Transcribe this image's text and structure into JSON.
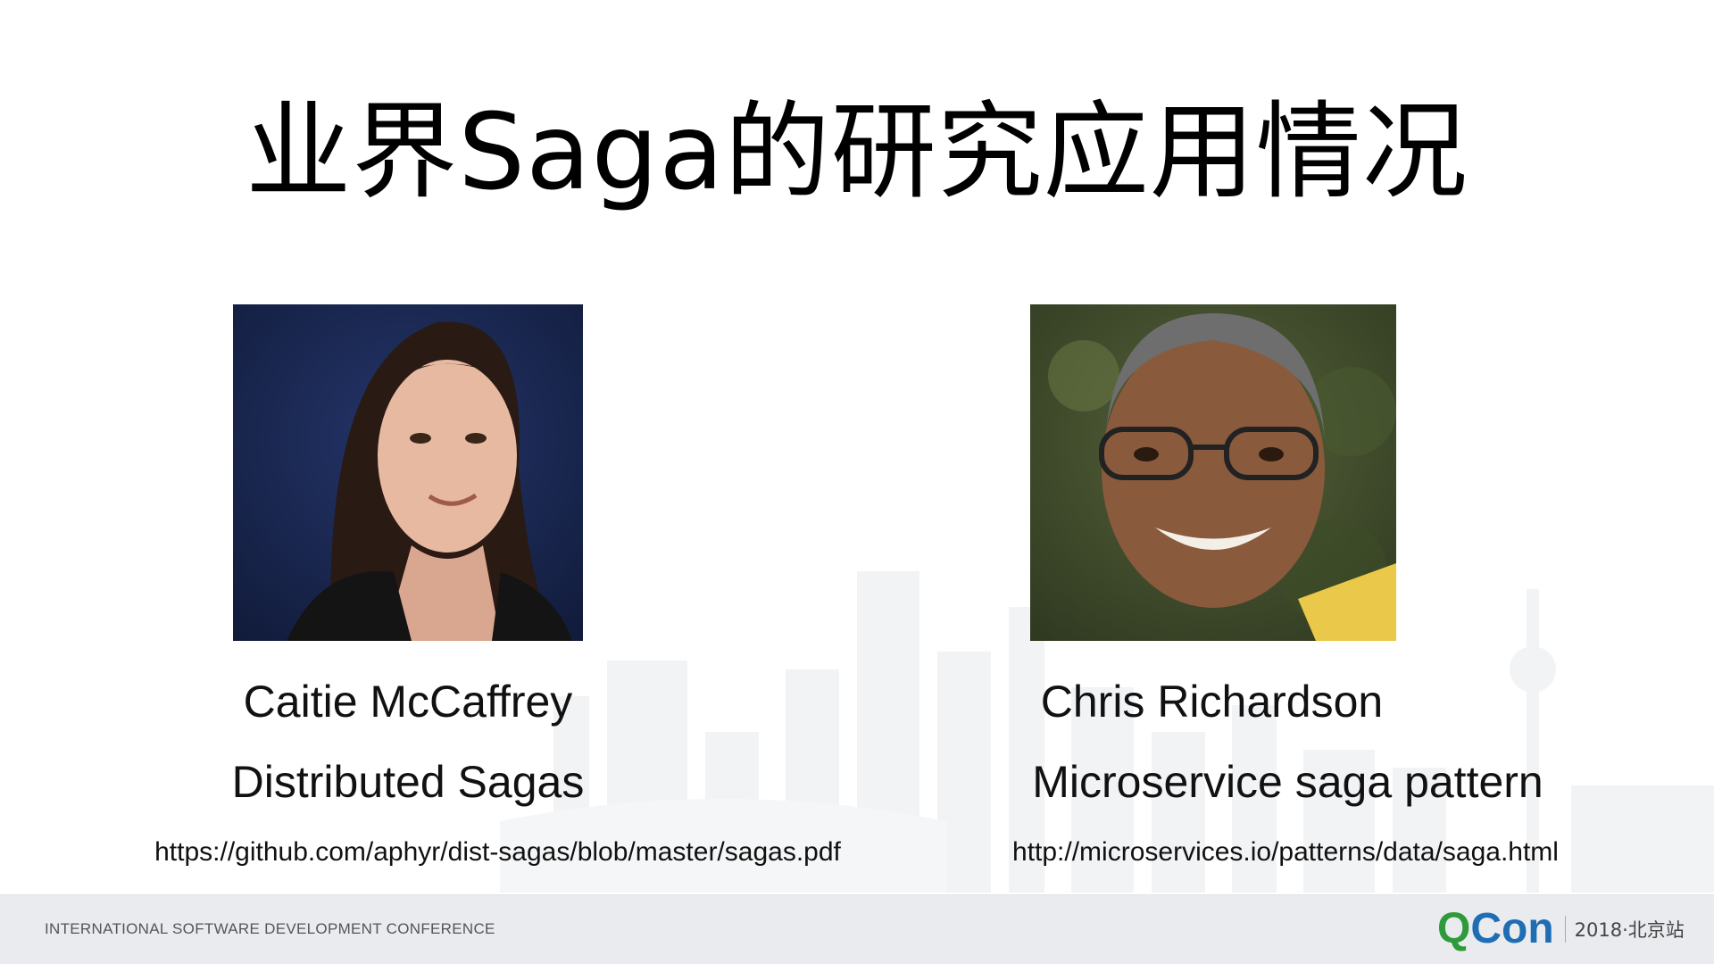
{
  "slide": {
    "title": "业界Saga的研究应用情况"
  },
  "speakers": [
    {
      "name": "Caitie McCaffrey",
      "topic": "Distributed Sagas",
      "link": "https://github.com/aphyr/dist-sagas/blob/master/sagas.pdf"
    },
    {
      "name": "Chris Richardson",
      "topic": "Microservice saga pattern",
      "link": "http://microservices.io/patterns/data/saga.html"
    }
  ],
  "footer": {
    "conference": "INTERNATIONAL SOFTWARE DEVELOPMENT CONFERENCE",
    "brand_q": "Q",
    "brand_con": "Con",
    "brand_edition": "2018·北京站"
  },
  "colors": {
    "brand_green": "#2f9a3a",
    "brand_blue": "#1f6db2",
    "footer_bg": "#e9ebee"
  }
}
